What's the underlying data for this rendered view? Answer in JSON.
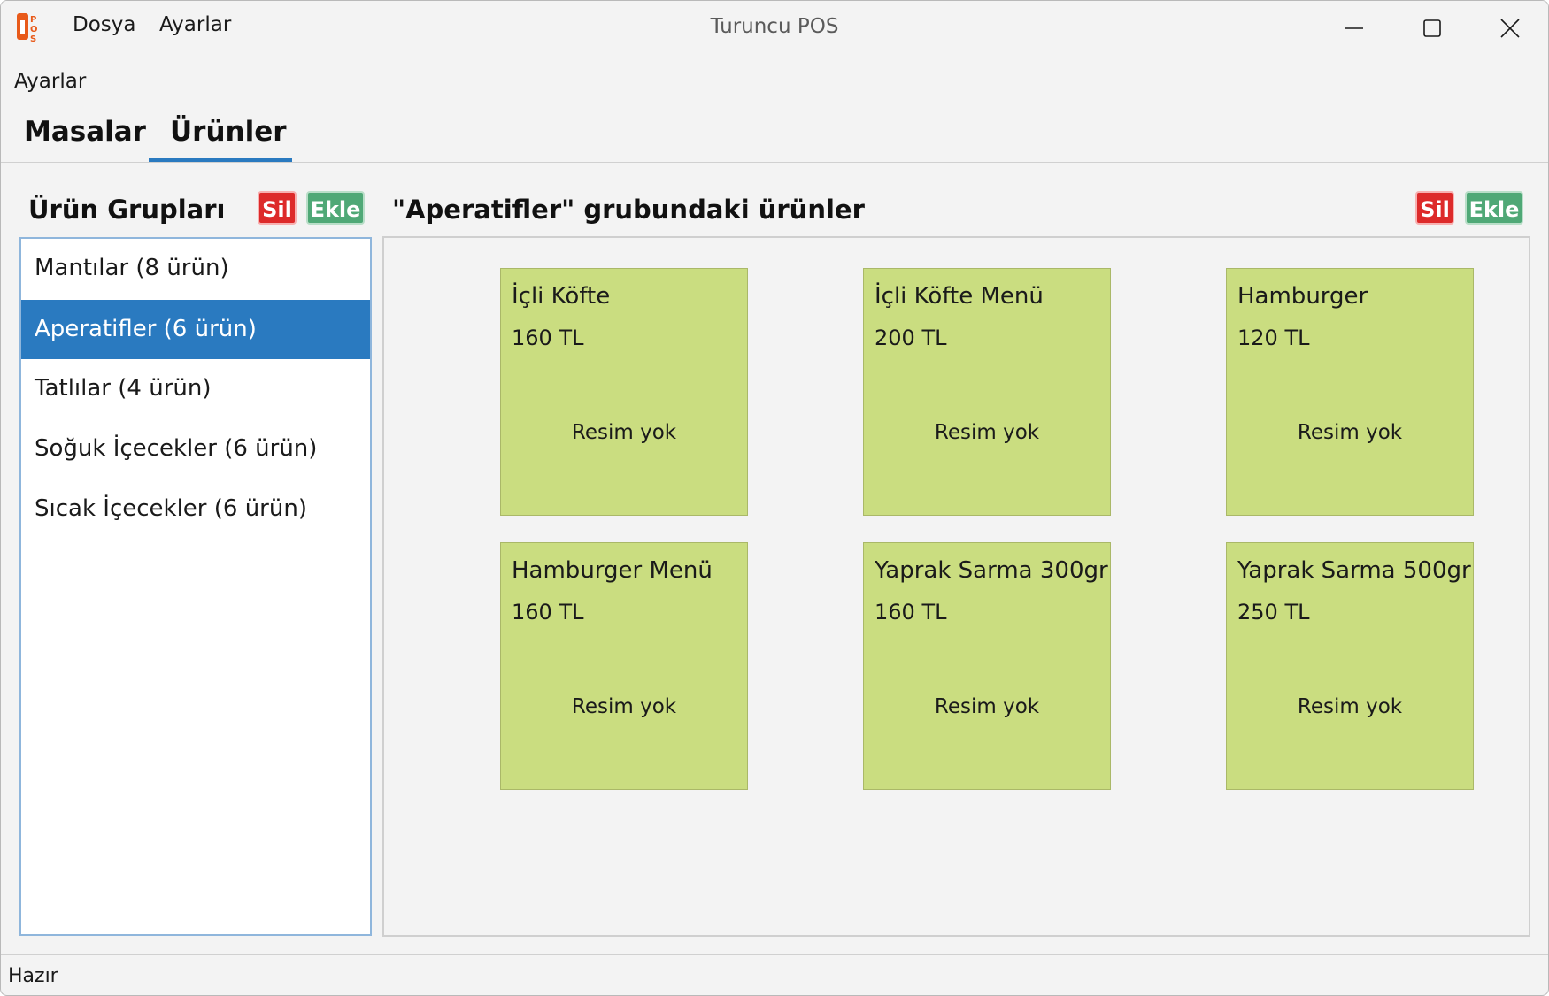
{
  "titlebar": {
    "title": "Turuncu POS",
    "menu": [
      "Dosya",
      "Ayarlar"
    ],
    "logo_icon": "turuncu-pos-logo",
    "controls": [
      "minimize-icon",
      "maximize-icon",
      "close-icon"
    ]
  },
  "ribbon": {
    "label": "Ayarlar"
  },
  "tabs": [
    {
      "label": "Masalar",
      "active": false
    },
    {
      "label": "Ürünler",
      "active": true
    }
  ],
  "groups_panel": {
    "title": "Ürün Grupları",
    "delete_label": "Sil",
    "add_label": "Ekle",
    "items": [
      {
        "label": "Mantılar (8 ürün)",
        "selected": false
      },
      {
        "label": "Aperatifler (6 ürün)",
        "selected": true
      },
      {
        "label": "Tatlılar (4 ürün)",
        "selected": false
      },
      {
        "label": "Soğuk İçecekler (6 ürün)",
        "selected": false
      },
      {
        "label": "Sıcak İçecekler (6 ürün)",
        "selected": false
      }
    ]
  },
  "products_panel": {
    "title": "\"Aperatifler\" grubundaki ürünler",
    "delete_label": "Sil",
    "add_label": "Ekle",
    "products": [
      {
        "name": "İçli Köfte",
        "price": "160 TL",
        "image_text": "Resim yok"
      },
      {
        "name": "İçli Köfte Menü",
        "price": "200 TL",
        "image_text": "Resim yok"
      },
      {
        "name": "Hamburger",
        "price": "120 TL",
        "image_text": "Resim yok"
      },
      {
        "name": "Hamburger Menü",
        "price": "160 TL",
        "image_text": "Resim yok"
      },
      {
        "name": "Yaprak Sarma 300gr",
        "price": "160 TL",
        "image_text": "Resim yok"
      },
      {
        "name": "Yaprak Sarma 500gr",
        "price": "250 TL",
        "image_text": "Resim yok"
      }
    ]
  },
  "status": {
    "text": "Hazır"
  },
  "colors": {
    "accent": "#2a7ac0",
    "delete": "#dd2a2a",
    "add": "#4fa876",
    "card": "#cadd80"
  }
}
